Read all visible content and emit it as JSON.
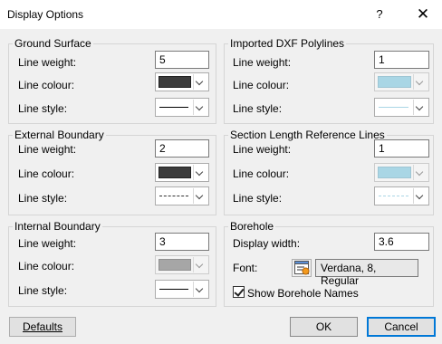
{
  "window": {
    "title": "Display Options",
    "help_glyph": "?",
    "close_glyph": "✕"
  },
  "labels": {
    "line_weight": "Line weight:",
    "line_colour": "Line colour:",
    "line_style": "Line style:"
  },
  "groups": {
    "ground_surface": {
      "title": "Ground Surface",
      "weight": "5",
      "colour": "#3c3c3c",
      "style": "solid"
    },
    "external_boundary": {
      "title": "External Boundary",
      "weight": "2",
      "colour": "#3c3c3c",
      "style": "dotted"
    },
    "internal_boundary": {
      "title": "Internal Boundary",
      "weight": "3",
      "colour": "#a6a6a6",
      "style": "solid",
      "colour_disabled": true
    },
    "imported_dxf": {
      "title": "Imported DXF Polylines",
      "weight": "1",
      "colour": "#a9d6e5",
      "style": "solid",
      "colour_disabled": true
    },
    "section_length": {
      "title": "Section Length Reference Lines",
      "weight": "1",
      "colour": "#a9d6e5",
      "style": "dashed",
      "colour_disabled": true
    },
    "borehole": {
      "title": "Borehole",
      "display_width_label": "Display width:",
      "display_width": "3.6",
      "font_label": "Font:",
      "font_value": "Verdana, 8, Regular",
      "show_names_label": "Show Borehole Names",
      "show_names_checked": true
    }
  },
  "buttons": {
    "defaults": "Defaults",
    "ok": "OK",
    "cancel": "Cancel"
  }
}
